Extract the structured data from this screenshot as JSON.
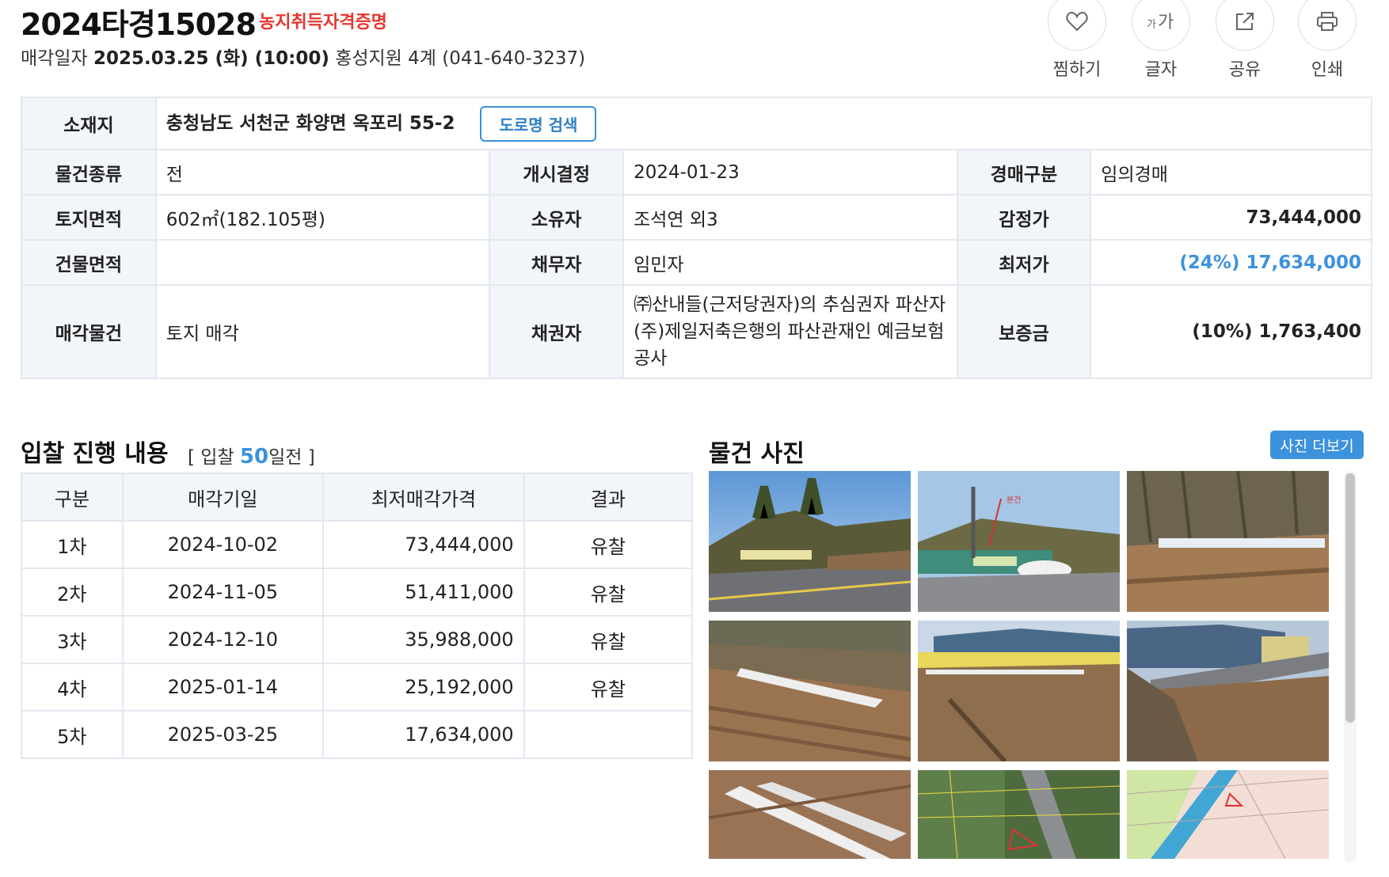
{
  "header": {
    "case_no": "2024타경15028",
    "farm_cert": "농지취득자격증명",
    "sale_label": "매각일자",
    "sale_date": "2025.03.25 (화) (10:00)",
    "court": "홍성지원 4계 (041-640-3237)"
  },
  "tools": [
    {
      "icon": "heart-icon",
      "label": "찜하기"
    },
    {
      "icon": "font-size-icon",
      "label": "글자"
    },
    {
      "icon": "share-icon",
      "label": "공유"
    },
    {
      "icon": "print-icon",
      "label": "인쇄"
    }
  ],
  "info": {
    "location_label": "소재지",
    "location": "충청남도 서천군 화양면 옥포리 55-2",
    "road_btn": "도로명 검색",
    "rows": [
      [
        "물건종류",
        "전",
        "개시결정",
        "2024-01-23",
        "경매구분",
        "임의경매"
      ],
      [
        "토지면적",
        "602㎡(182.105평)",
        "소유자",
        "조석연 외3",
        "감정가",
        "73,444,000"
      ],
      [
        "건물면적",
        "",
        "채무자",
        "임민자",
        "최저가",
        "(24%) 17,634,000"
      ],
      [
        "매각물건",
        "토지 매각",
        "채권자",
        "㈜산내들(근저당권자)의 추심권자 파산자 (주)제일저축은행의 파산관재인 예금보험공사",
        "보증금",
        "(10%) 1,763,400"
      ]
    ]
  },
  "bid": {
    "title": "입찰 진행 내용",
    "sub_prefix": "[ 입찰",
    "sub_days": "50",
    "sub_suffix": "일전 ]",
    "columns": [
      "구분",
      "매각기일",
      "최저매각가격",
      "결과"
    ],
    "rows": [
      [
        "1차",
        "2024-10-02",
        "73,444,000",
        "유찰"
      ],
      [
        "2차",
        "2024-11-05",
        "51,411,000",
        "유찰"
      ],
      [
        "3차",
        "2024-12-10",
        "35,988,000",
        "유찰"
      ],
      [
        "4차",
        "2025-01-14",
        "25,192,000",
        "유찰"
      ],
      [
        "5차",
        "2025-03-25",
        "17,634,000",
        ""
      ]
    ]
  },
  "photos": {
    "title": "물건 사진",
    "more_btn": "사진 더보기",
    "photo_arrow_label": "본건"
  }
}
